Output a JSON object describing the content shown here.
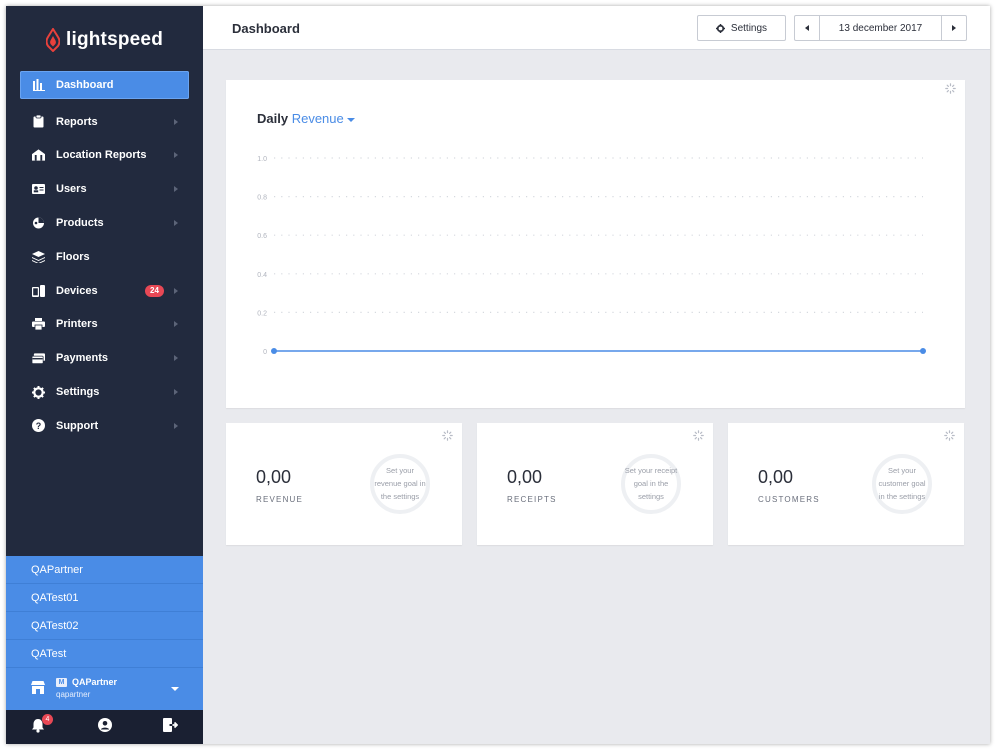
{
  "brand": {
    "name": "lightspeed",
    "accent": "#4a8ce6",
    "flame": "#e8413c",
    "sidebar_bg": "#222a3e"
  },
  "sidebar": {
    "items": [
      {
        "label": "Dashboard",
        "icon": "bar-chart-icon",
        "active": true
      },
      {
        "label": "Reports",
        "icon": "clipboard-icon"
      },
      {
        "label": "Location Reports",
        "icon": "building-icon"
      },
      {
        "label": "Users",
        "icon": "id-card-icon"
      },
      {
        "label": "Products",
        "icon": "products-icon"
      },
      {
        "label": "Floors",
        "icon": "layers-icon"
      },
      {
        "label": "Devices",
        "icon": "devices-icon",
        "badge": "24"
      },
      {
        "label": "Printers",
        "icon": "printer-icon"
      },
      {
        "label": "Payments",
        "icon": "credit-card-icon"
      },
      {
        "label": "Settings",
        "icon": "gear-icon"
      },
      {
        "label": "Support",
        "icon": "help-icon"
      }
    ],
    "accounts": [
      "QAPartner",
      "QATest01",
      "QATest02",
      "QATest"
    ],
    "current_account": {
      "badge": "M",
      "name": "QAPartner",
      "username": "qapartner"
    },
    "notifications_count": "4"
  },
  "header": {
    "title": "Dashboard",
    "settings_label": "Settings",
    "date": "13 december 2017"
  },
  "chart_data": {
    "type": "line",
    "title_prefix": "Daily",
    "metric": "Revenue",
    "y_ticks": [
      "0",
      "0.2",
      "0.4",
      "0.6",
      "0.8",
      "1.0"
    ],
    "ylim": [
      0,
      1.0
    ],
    "grid": true,
    "series": [
      {
        "values": [
          0,
          0
        ]
      }
    ]
  },
  "stats": [
    {
      "value": "0,00",
      "label": "REVENUE",
      "goal_text": [
        "Set your",
        "revenue goal in",
        "the settings"
      ]
    },
    {
      "value": "0,00",
      "label": "RECEIPTS",
      "goal_text": [
        "Set your receipt",
        "goal in the",
        "settings"
      ]
    },
    {
      "value": "0,00",
      "label": "CUSTOMERS",
      "goal_text": [
        "Set your",
        "customer goal",
        "in the settings"
      ]
    }
  ]
}
